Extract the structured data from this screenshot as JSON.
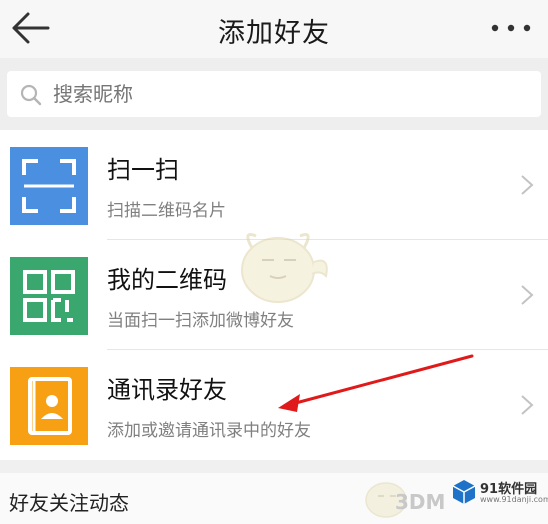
{
  "header": {
    "title": "添加好友",
    "back_icon": "arrow-left-icon",
    "more_icon": "more-dots-icon"
  },
  "search": {
    "placeholder": "搜索昵称",
    "icon": "search-icon"
  },
  "rows": [
    {
      "title": "扫一扫",
      "subtitle": "扫描二维码名片",
      "icon": "scan-icon",
      "icon_color": "#4a8fe0"
    },
    {
      "title": "我的二维码",
      "subtitle": "当面扫一扫添加微博好友",
      "icon": "qr-code-icon",
      "icon_color": "#3aa86e"
    },
    {
      "title": "通讯录好友",
      "subtitle": "添加或邀请通讯录中的好友",
      "icon": "contacts-book-icon",
      "icon_color": "#f7a013"
    }
  ],
  "section": {
    "label": "好友关注动态"
  },
  "annotation": {
    "arrow_color": "#e01a1a"
  },
  "watermark": {
    "site_name": "91软件园",
    "site_url": "www.91danji.com",
    "brand_text": "3DM"
  }
}
